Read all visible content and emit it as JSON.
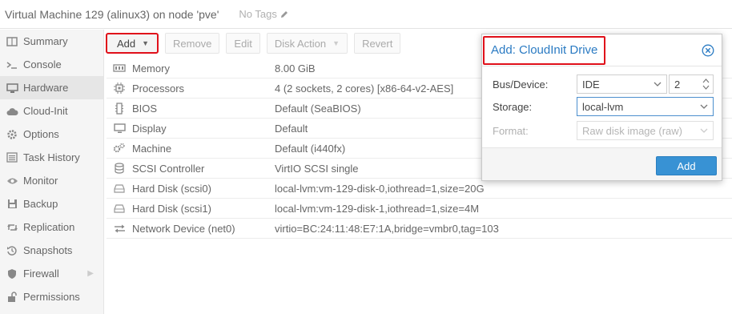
{
  "header": {
    "title": "Virtual Machine 129 (alinux3) on node 'pve'",
    "tags_label": "No Tags"
  },
  "sidebar": {
    "items": [
      {
        "label": "Summary",
        "icon": "book-icon"
      },
      {
        "label": "Console",
        "icon": "terminal-icon"
      },
      {
        "label": "Hardware",
        "icon": "monitor-icon",
        "active": true
      },
      {
        "label": "Cloud-Init",
        "icon": "cloud-icon"
      },
      {
        "label": "Options",
        "icon": "gear-icon"
      },
      {
        "label": "Task History",
        "icon": "list-icon"
      },
      {
        "label": "Monitor",
        "icon": "eye-icon"
      },
      {
        "label": "Backup",
        "icon": "floppy-icon"
      },
      {
        "label": "Replication",
        "icon": "retweet-icon"
      },
      {
        "label": "Snapshots",
        "icon": "history-icon"
      },
      {
        "label": "Firewall",
        "icon": "shield-icon"
      },
      {
        "label": "Permissions",
        "icon": "unlock-icon"
      }
    ]
  },
  "toolbar": {
    "add": "Add",
    "remove": "Remove",
    "edit": "Edit",
    "disk_action": "Disk Action",
    "revert": "Revert"
  },
  "hardware": {
    "rows": [
      {
        "name": "Memory",
        "value": "8.00 GiB",
        "icon": "memory-icon"
      },
      {
        "name": "Processors",
        "value": "4 (2 sockets, 2 cores) [x86-64-v2-AES]",
        "icon": "cpu-icon"
      },
      {
        "name": "BIOS",
        "value": "Default (SeaBIOS)",
        "icon": "chip-icon"
      },
      {
        "name": "Display",
        "value": "Default",
        "icon": "desktop-icon"
      },
      {
        "name": "Machine",
        "value": "Default (i440fx)",
        "icon": "cogs-icon"
      },
      {
        "name": "SCSI Controller",
        "value": "VirtIO SCSI single",
        "icon": "database-icon"
      },
      {
        "name": "Hard Disk (scsi0)",
        "value": "local-lvm:vm-129-disk-0,iothread=1,size=20G",
        "icon": "hdd-icon"
      },
      {
        "name": "Hard Disk (scsi1)",
        "value": "local-lvm:vm-129-disk-1,iothread=1,size=4M",
        "icon": "hdd-icon"
      },
      {
        "name": "Network Device (net0)",
        "value": "virtio=BC:24:11:48:E7:1A,bridge=vmbr0,tag=103",
        "icon": "exchange-icon"
      }
    ]
  },
  "dialog": {
    "title": "Add: CloudInit Drive",
    "bus_label": "Bus/Device:",
    "bus_value": "IDE",
    "device_value": "2",
    "storage_label": "Storage:",
    "storage_value": "local-lvm",
    "format_label": "Format:",
    "format_value": "Raw disk image (raw)",
    "ok_label": "Add"
  },
  "colors": {
    "accent": "#2b7bc3",
    "highlight_border": "#e0101a",
    "primary_button": "#3892d4"
  }
}
